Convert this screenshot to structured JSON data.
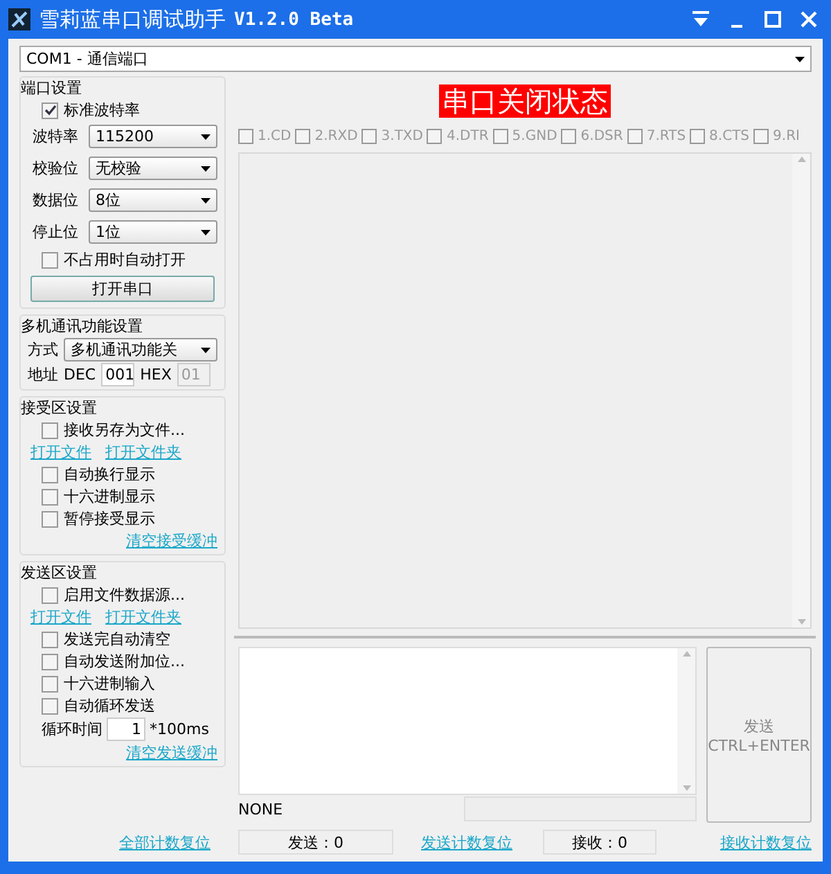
{
  "window": {
    "title": "雪莉蓝串口调试助手",
    "version": "V1.2.0 Beta"
  },
  "port_select": {
    "value": "COM1 - 通信端口"
  },
  "port_settings": {
    "title": "端口设置",
    "standard_baud": {
      "label": "标准波特率",
      "checked": true
    },
    "fields": [
      {
        "label": "波特率",
        "value": "115200"
      },
      {
        "label": "校验位",
        "value": "无校验"
      },
      {
        "label": "数据位",
        "value": "8位"
      },
      {
        "label": "停止位",
        "value": "1位"
      }
    ],
    "auto_open": {
      "label": "不占用时自动打开",
      "checked": false
    },
    "open_button": "打开串口"
  },
  "multi_settings": {
    "title": "多机通讯功能设置",
    "mode_label": "方式",
    "mode_value": "多机通讯功能关",
    "address_label": "地址",
    "dec_label": "DEC",
    "dec_value": "001",
    "hex_label": "HEX",
    "hex_value": "01",
    "hex_disabled": true
  },
  "receive_settings": {
    "title": "接受区设置",
    "items": [
      {
        "kind": "checkbox",
        "label": "接收另存为文件...",
        "checked": false
      },
      {
        "kind": "links",
        "links": [
          "打开文件",
          "打开文件夹"
        ]
      },
      {
        "kind": "checkbox",
        "label": "自动换行显示",
        "checked": false
      },
      {
        "kind": "checkbox",
        "label": "十六进制显示",
        "checked": false
      },
      {
        "kind": "checkbox",
        "label": "暂停接受显示",
        "checked": false
      }
    ],
    "clear_link": "清空接受缓冲"
  },
  "send_settings": {
    "title": "发送区设置",
    "items": [
      {
        "kind": "checkbox",
        "label": "启用文件数据源...",
        "checked": false
      },
      {
        "kind": "links",
        "links": [
          "打开文件",
          "打开文件夹"
        ]
      },
      {
        "kind": "checkbox",
        "label": "发送完自动清空",
        "checked": false
      },
      {
        "kind": "checkbox",
        "label": "自动发送附加位...",
        "checked": false
      },
      {
        "kind": "checkbox",
        "label": "十六进制输入",
        "checked": false
      },
      {
        "kind": "checkbox",
        "label": "自动循环发送",
        "checked": false
      }
    ],
    "cycle_label": "循环时间",
    "cycle_value": "1",
    "cycle_unit": "*100ms",
    "clear_link": "清空发送缓冲"
  },
  "status_banner": "串口关闭状态",
  "signals": [
    {
      "label": "1.CD",
      "checked": false
    },
    {
      "label": "2.RXD",
      "checked": false
    },
    {
      "label": "3.TXD",
      "checked": false
    },
    {
      "label": "4.DTR",
      "checked": false
    },
    {
      "label": "5.GND",
      "checked": false
    },
    {
      "label": "6.DSR",
      "checked": false
    },
    {
      "label": "7.RTS",
      "checked": false
    },
    {
      "label": "8.CTS",
      "checked": false
    },
    {
      "label": "9.RI",
      "checked": false
    }
  ],
  "send_button": {
    "label": "发送",
    "hint": "CTRL+ENTER",
    "disabled": true
  },
  "status_text": "NONE",
  "footer": {
    "reset_all": "全部计数复位",
    "sent": "发送：0",
    "reset_sent": "发送计数复位",
    "received": "接收：0",
    "reset_received": "接收计数复位"
  }
}
